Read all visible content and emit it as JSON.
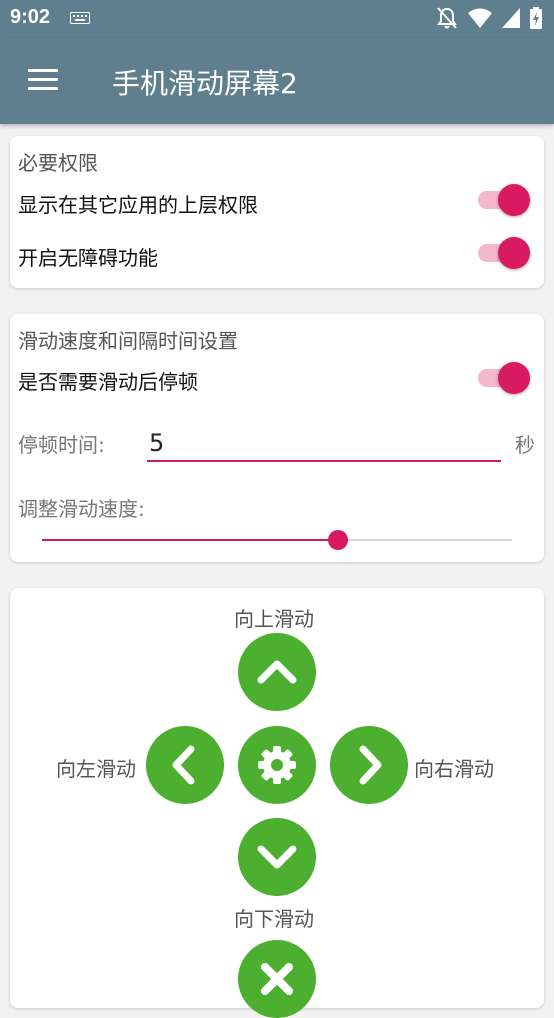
{
  "status_bar": {
    "time": "9:02",
    "icons": [
      "keyboard-icon",
      "notifications-off-icon",
      "wifi-icon",
      "signal-icon",
      "battery-charging-icon"
    ]
  },
  "app_bar": {
    "title": "手机滑动屏幕2",
    "menu_icon": "hamburger-menu-icon"
  },
  "permissions": {
    "title": "必要权限",
    "overlay_label": "显示在其它应用的上层权限",
    "overlay_enabled": true,
    "accessibility_label": "开启无障碍功能",
    "accessibility_enabled": true
  },
  "speed_settings": {
    "title": "滑动速度和间隔时间设置",
    "pause_label": "是否需要滑动后停顿",
    "pause_enabled": true,
    "pause_time_label": "停顿时间:",
    "pause_time_value": "5",
    "pause_time_unit": "秒",
    "speed_label": "调整滑动速度:",
    "speed_fraction": 0.63
  },
  "controls": {
    "up_label": "向上滑动",
    "down_label": "向下滑动",
    "left_label": "向左滑动",
    "right_label": "向右滑动",
    "button_color": "#4caf2f"
  },
  "colors": {
    "app_bar": "#5f7f8f",
    "accent": "#d81b60",
    "switch_track": "#f3b8cc"
  }
}
